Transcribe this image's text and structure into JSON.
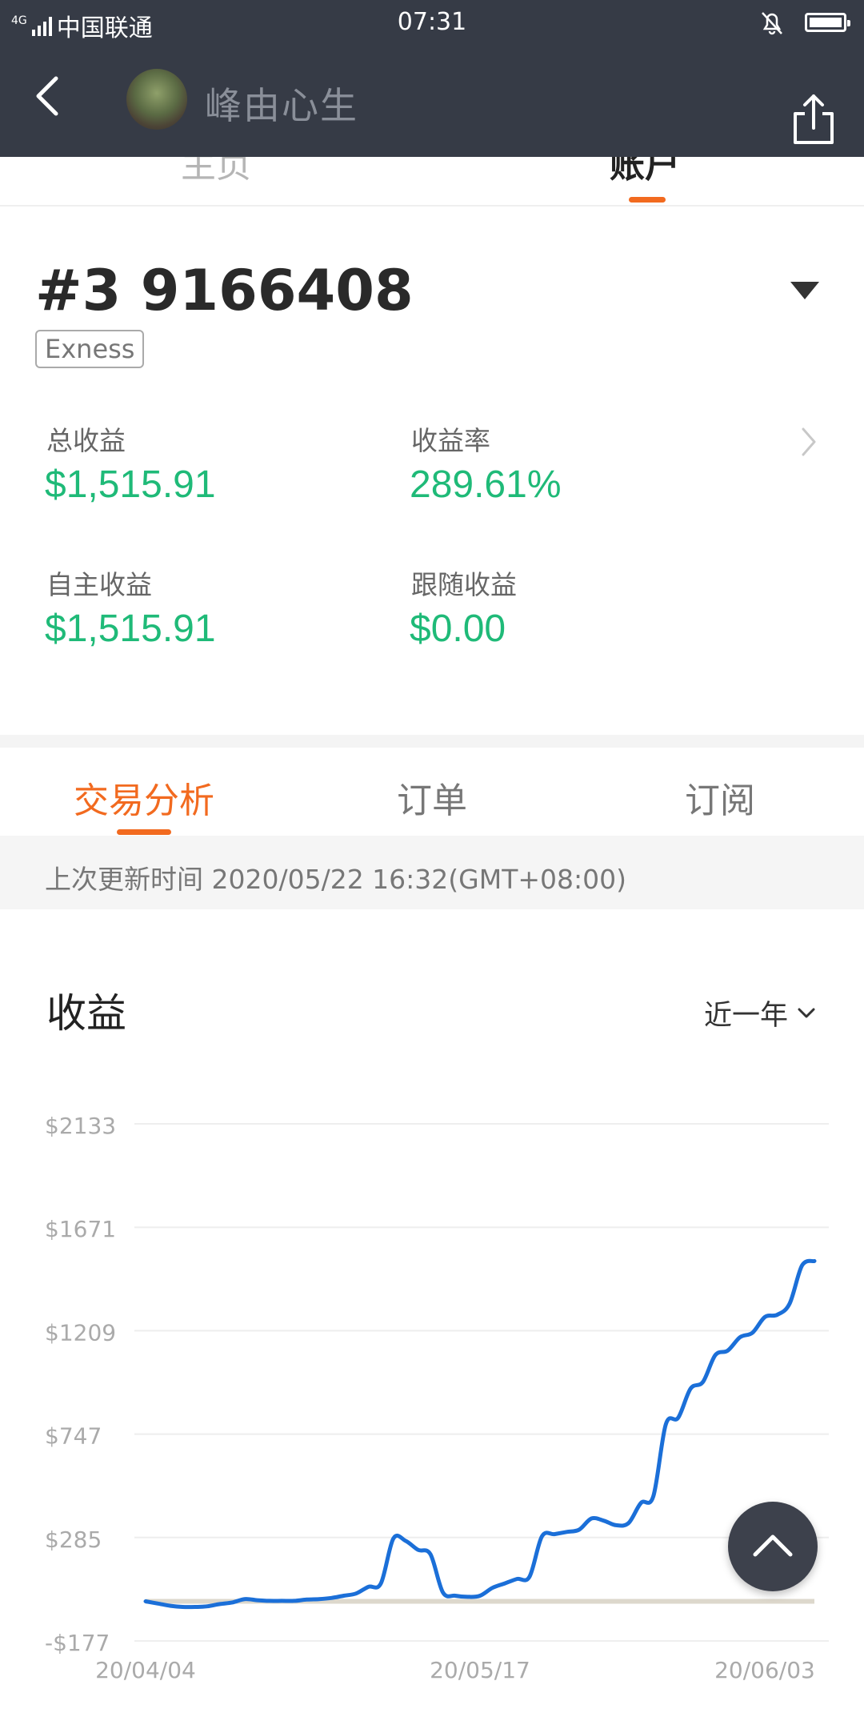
{
  "status_bar": {
    "network": "4G",
    "carrier": "中国联通",
    "time": "07:31"
  },
  "header": {
    "username": "峰由心生"
  },
  "profile_tabs": {
    "home": "主页",
    "account": "账户"
  },
  "account": {
    "number": "#3 9166408",
    "broker": "Exness"
  },
  "stats": [
    {
      "label": "总收益",
      "value": "$1,515.91"
    },
    {
      "label": "收益率",
      "value": "289.61%"
    },
    {
      "label": "自主收益",
      "value": "$1,515.91"
    },
    {
      "label": "跟随收益",
      "value": "$0.00"
    }
  ],
  "analysis_tabs": [
    "交易分析",
    "订单",
    "订阅"
  ],
  "update_text": "上次更新时间 2020/05/22 16:32(GMT+08:00)",
  "chart_section": {
    "title": "收益",
    "range": "近一年"
  },
  "colors": {
    "header_bg": "#363b46",
    "accent": "#f26a1f",
    "positive": "#1fba78",
    "line": "#1b6fd8",
    "baseline": "#ddd8cc"
  },
  "chart_data": {
    "type": "line",
    "title": "",
    "xlabel": "",
    "ylabel": "",
    "y_ticks": [
      "$2133",
      "$1671",
      "$1209",
      "$747",
      "$285",
      "-$177"
    ],
    "x_ticks": [
      "20/04/04",
      "20/05/17",
      "20/06/03"
    ],
    "ylim": [
      -177,
      2133
    ],
    "grid": true,
    "series": [
      {
        "values": [
          0,
          -10,
          -20,
          -25,
          -25,
          -22,
          -12,
          -5,
          10,
          5,
          2,
          2,
          2,
          8,
          10,
          15,
          25,
          35,
          65,
          80,
          280,
          270,
          230,
          210,
          40,
          25,
          20,
          25,
          60,
          80,
          100,
          110,
          290,
          300,
          310,
          320,
          370,
          360,
          340,
          350,
          440,
          470,
          790,
          820,
          950,
          980,
          1100,
          1120,
          1180,
          1200,
          1270,
          1280,
          1330,
          1500,
          1520
        ]
      }
    ]
  }
}
